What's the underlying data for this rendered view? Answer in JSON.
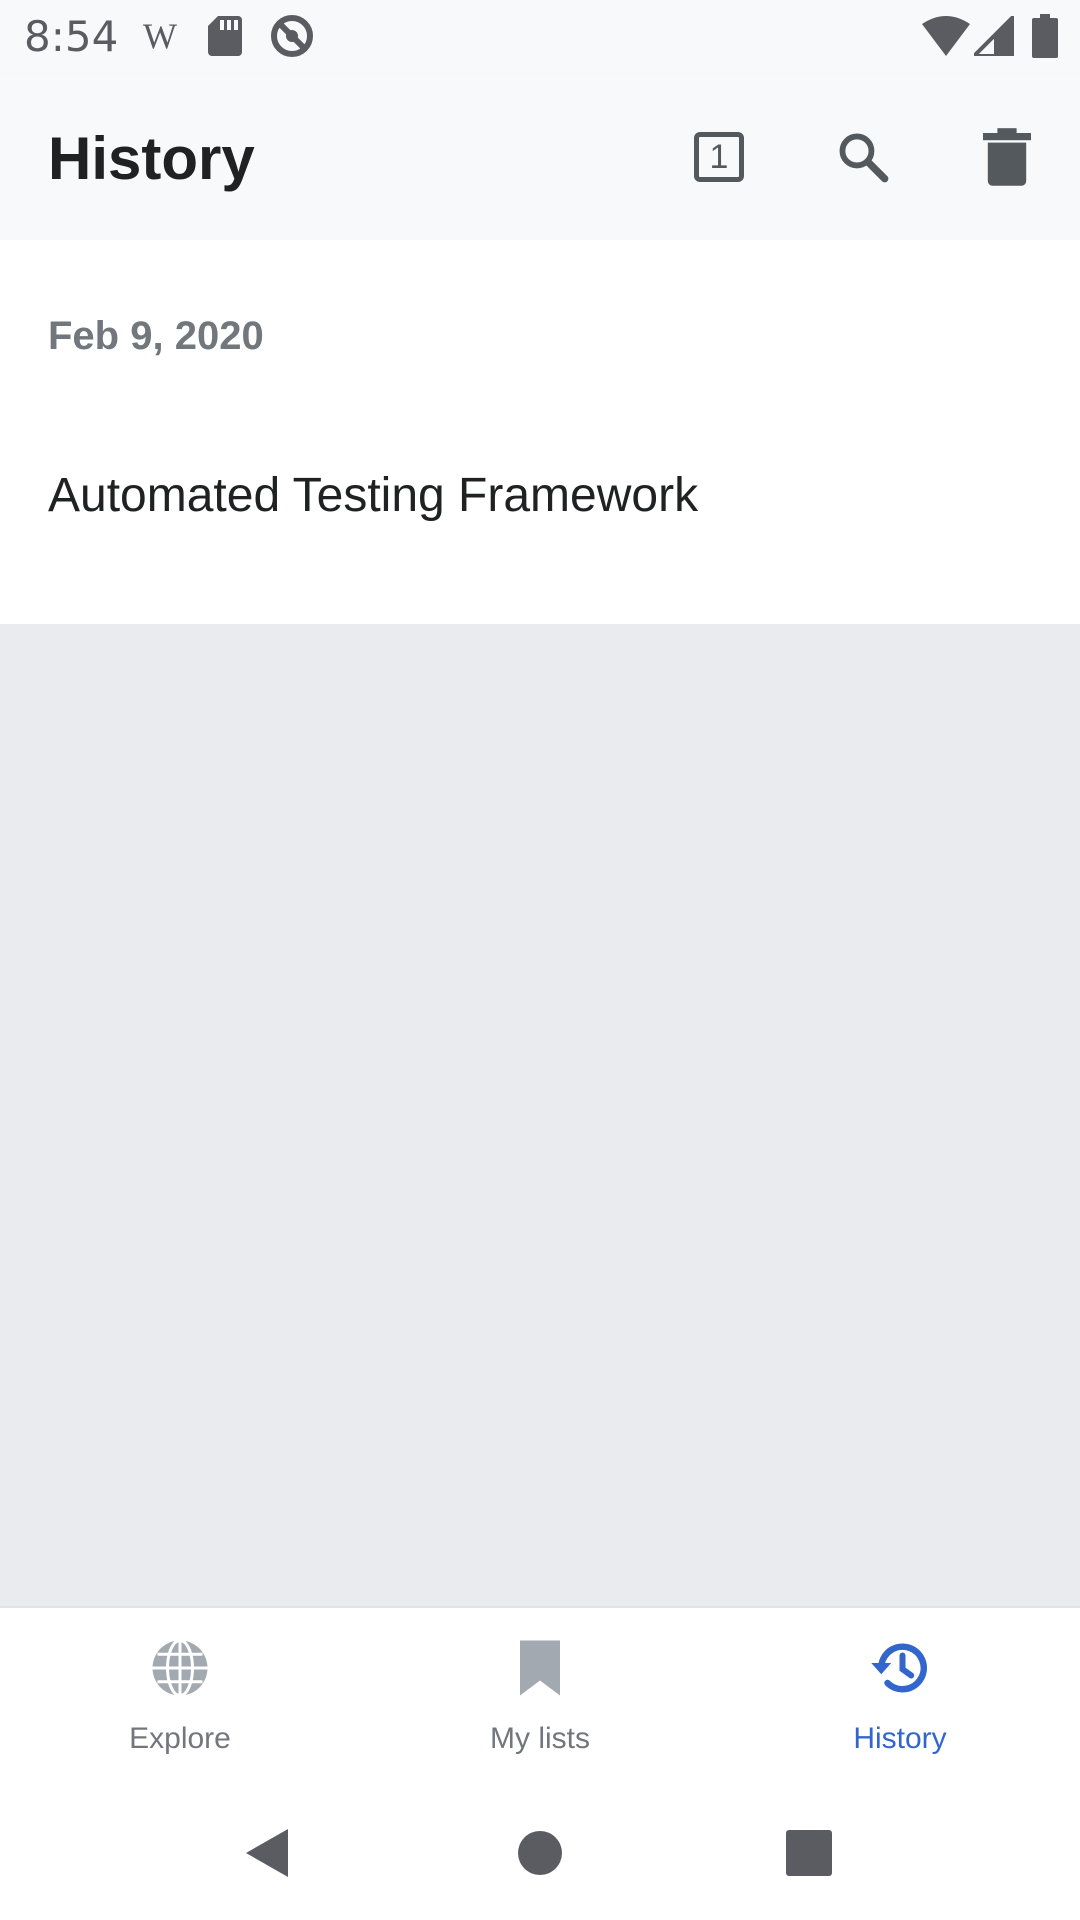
{
  "status_bar": {
    "time": "8:54",
    "icons": [
      "wikipedia-icon",
      "sd-card-icon",
      "do-not-disturb-icon",
      "wifi-icon",
      "cell-signal-icon",
      "battery-icon"
    ]
  },
  "app_bar": {
    "title": "History",
    "tabs_count": "1",
    "actions": [
      "tabs-icon",
      "search-icon",
      "trash-icon"
    ]
  },
  "history": {
    "sections": [
      {
        "date": "Feb 9, 2020",
        "items": [
          {
            "title": "Automated Testing Framework"
          }
        ]
      }
    ]
  },
  "bottom_nav": {
    "items": [
      {
        "label": "Explore",
        "icon": "globe-icon",
        "active": false
      },
      {
        "label": "My lists",
        "icon": "bookmark-icon",
        "active": false
      },
      {
        "label": "History",
        "icon": "history-icon",
        "active": true
      }
    ]
  },
  "colors": {
    "accent": "#3366cc",
    "inactive": "#72777d",
    "background": "#eaebef",
    "surface": "#ffffff",
    "app_bar": "#f8f9fa"
  },
  "system_nav": [
    "back-icon",
    "home-icon",
    "recents-icon"
  ]
}
